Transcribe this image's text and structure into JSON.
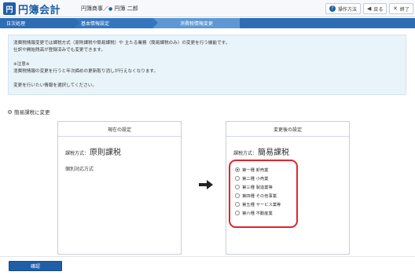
{
  "header": {
    "logo_glyph": "円",
    "app_name": "円簿会計",
    "company": "円簿商事／",
    "user_sep": "●",
    "user": "円簿 二郎",
    "buttons": [
      {
        "icon": "help-icon",
        "glyph": "?",
        "label": "操作方法"
      },
      {
        "icon": "back-icon",
        "glyph": "◀",
        "label": "戻る"
      },
      {
        "icon": "close-icon",
        "glyph": "✕",
        "label": "終了"
      }
    ]
  },
  "breadcrumb": [
    "日次処理",
    "基本情報設定",
    "消費税情報変更"
  ],
  "info": {
    "lines": [
      "消費税情報変更では課税方式（原則課税や簡易課税）や 主たる業務（簡易課税のみ）の変更を行う機能です。",
      "仕訳や開始残高が登録済みでも変更できます。",
      "",
      "※注意※",
      "消費税情報の変更を行うと年次締めの更新取り消しが行えなくなります。",
      "",
      "変更を行いたい情報を選択してください。"
    ]
  },
  "section": {
    "label": "簡易課税に変更"
  },
  "current": {
    "title": "現在の設定",
    "method_label": "課税方式：",
    "method_value": "原則課税",
    "sub": "個別対応方式"
  },
  "after": {
    "title": "変更後の設定",
    "method_label": "課税方式：",
    "method_value": "簡易課税",
    "options": [
      {
        "label": "第一種 卸売業",
        "selected": true
      },
      {
        "label": "第二種 小売業",
        "selected": false
      },
      {
        "label": "第三種 製造業等",
        "selected": false
      },
      {
        "label": "第四種 その他事業",
        "selected": false
      },
      {
        "label": "第五種 サービス業等",
        "selected": false
      },
      {
        "label": "第六種 不動産業",
        "selected": false
      }
    ],
    "highlight_color": "#e0242c"
  },
  "confirm_label": "確認",
  "colors": {
    "brand": "#1f5fa8",
    "breadcrumb": "#2d6db5",
    "info_bg": "#e9f4fa"
  }
}
